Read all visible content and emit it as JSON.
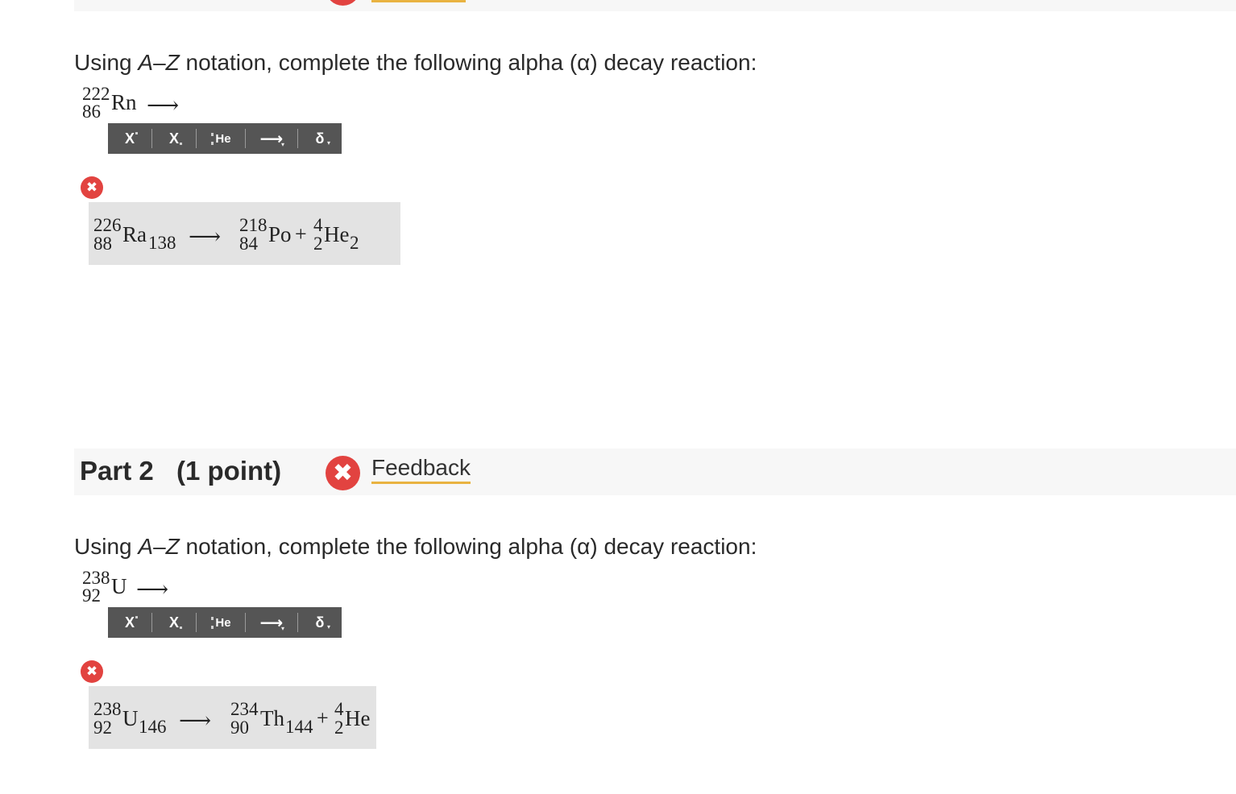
{
  "part1": {
    "question_prefix": "Using ",
    "question_A": "A",
    "question_dash": "–",
    "question_Z": "Z",
    "question_suffix": " notation, complete the following alpha (α) decay reaction:",
    "reactant": {
      "mass": "222",
      "atomic": "86",
      "symbol": "Rn"
    },
    "arrow": "⟶",
    "answer": {
      "r_mass": "226",
      "r_atomic": "88",
      "r_symbol": "Ra",
      "r_neutrons": "138",
      "arrow": "⟶",
      "p1_mass": "218",
      "p1_atomic": "84",
      "p1_symbol": "Po",
      "plus": "+",
      "p2_mass": "4",
      "p2_atomic": "2",
      "p2_symbol": "He",
      "p2_neutrons": "2"
    }
  },
  "part2": {
    "title": "Part 2",
    "points": "(1 point)",
    "feedback_label": "Feedback",
    "question_prefix": "Using ",
    "question_A": "A",
    "question_dash": "–",
    "question_Z": "Z",
    "question_suffix": " notation, complete the following alpha (α) decay reaction:",
    "reactant": {
      "mass": "238",
      "atomic": "92",
      "symbol": "U"
    },
    "arrow": "⟶",
    "answer": {
      "r_mass": "238",
      "r_atomic": "92",
      "r_symbol": "U",
      "r_neutrons": "146",
      "arrow": "⟶",
      "p1_mass": "234",
      "p1_atomic": "90",
      "p1_symbol": "Th",
      "p1_neutrons": "144",
      "plus": "+",
      "p2_mass": "4",
      "p2_atomic": "2",
      "p2_symbol": "He"
    }
  },
  "toolbar": {
    "superscript_label": "X",
    "subscript_label": "X",
    "nuclide_label": "He",
    "arrow_label": "⟶",
    "delta_label": "δ",
    "caret": "▾"
  },
  "icons": {
    "error": "✖"
  },
  "colors": {
    "error_red": "#e24340",
    "feedback_underline": "#e9b341",
    "toolbar_bg": "#555555",
    "answer_bg": "#e3e3e3",
    "header_bg": "#f7f7f7"
  }
}
